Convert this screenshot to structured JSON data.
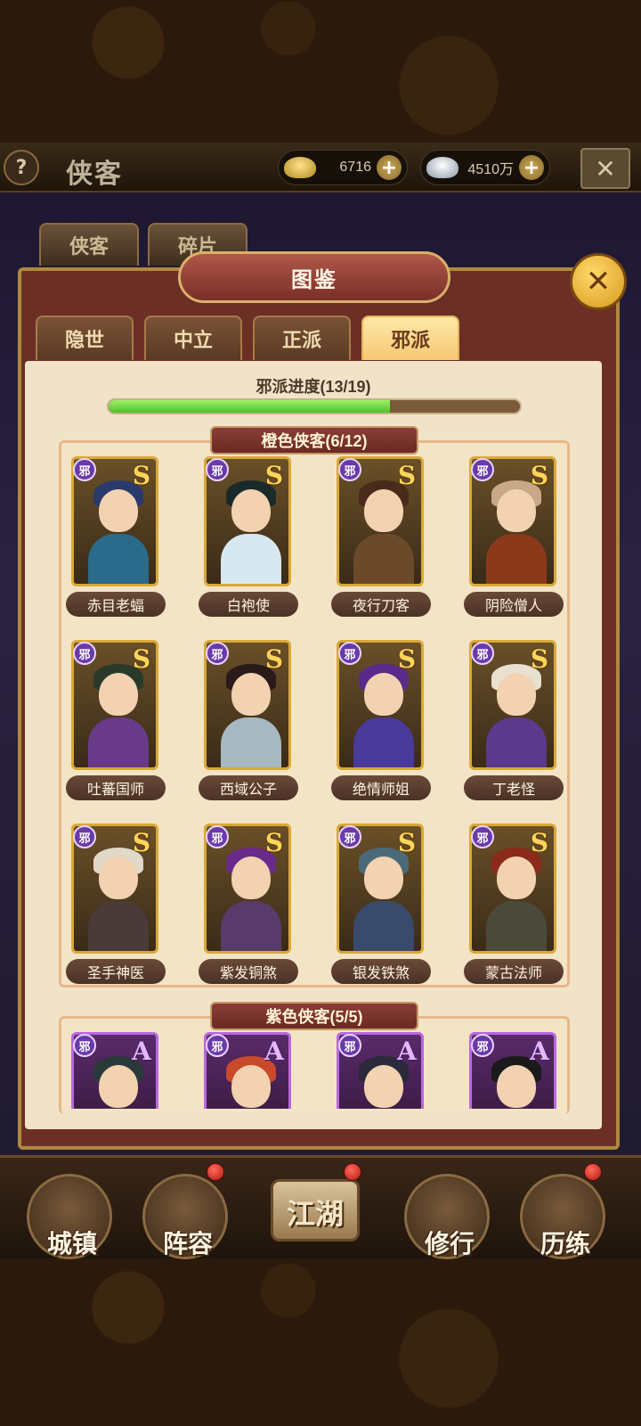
{
  "header": {
    "help_icon": "?",
    "title": "侠客",
    "gold": {
      "icon": "gold-ingot-icon",
      "value": "6716"
    },
    "silver": {
      "icon": "silver-ingot-icon",
      "value": "4510万"
    },
    "plus": "+",
    "close_icon": "✕"
  },
  "back_tabs": [
    "侠客",
    "碎片"
  ],
  "panel": {
    "title": "图鉴",
    "close_icon": "✕",
    "tabs": [
      "隐世",
      "中立",
      "正派",
      "邪派"
    ],
    "active_tab": "邪派",
    "progress_label": "邪派进度(13/19)",
    "progress_fraction": 0.684
  },
  "sections": {
    "orange": {
      "title": "橙色侠客(6/12)",
      "grade": "S",
      "heroes": [
        {
          "name": "赤目老蝠",
          "badge": "邪",
          "hair": "#2a3a6a",
          "body": "#2a6a8a"
        },
        {
          "name": "白袍使",
          "badge": "邪",
          "hair": "#1a2a2a",
          "body": "#d8e8f0"
        },
        {
          "name": "夜行刀客",
          "badge": "邪",
          "hair": "#4a2a1a",
          "body": "#6a4a2a"
        },
        {
          "name": "阴险僧人",
          "badge": "邪",
          "hair": "#c8a888",
          "body": "#8a3a1a"
        },
        {
          "name": "吐蕃国师",
          "badge": "邪",
          "hair": "#2a3a2a",
          "body": "#6a3a8a"
        },
        {
          "name": "西域公子",
          "badge": "邪",
          "hair": "#2a1a1a",
          "body": "#a8b8c0"
        },
        {
          "name": "绝情师姐",
          "badge": "邪",
          "hair": "#5a2a8a",
          "body": "#4a3a9a"
        },
        {
          "name": "丁老怪",
          "badge": "邪",
          "hair": "#e8e0d0",
          "body": "#5a3a8a"
        },
        {
          "name": "圣手神医",
          "badge": "邪",
          "hair": "#e0d8c8",
          "body": "#4a3a3a"
        },
        {
          "name": "紫发铜煞",
          "badge": "邪",
          "hair": "#6a2a8a",
          "body": "#5a3a6a"
        },
        {
          "name": "银发铁煞",
          "badge": "邪",
          "hair": "#4a6a7a",
          "body": "#3a4a6a"
        },
        {
          "name": "蒙古法师",
          "badge": "邪",
          "hair": "#8a2a1a",
          "body": "#4a4a3a"
        }
      ]
    },
    "purple": {
      "title": "紫色侠客(5/5)",
      "grade": "A",
      "heroes": [
        {
          "badge": "邪",
          "hair": "#2a3a3a",
          "body": "#3a4a4a"
        },
        {
          "badge": "邪",
          "hair": "#c84a2a",
          "body": "#6a3a2a"
        },
        {
          "badge": "邪",
          "hair": "#2a2a3a",
          "body": "#5a4a6a"
        },
        {
          "badge": "邪",
          "hair": "#1a1a1a",
          "body": "#3a2a3a"
        }
      ]
    }
  },
  "bottom_nav": [
    {
      "label": "城镇",
      "icon": "town-icon"
    },
    {
      "label": "阵容",
      "icon": "lineup-icon"
    },
    {
      "label": "江湖",
      "icon": "jianghu-scroll-icon"
    },
    {
      "label": "修行",
      "icon": "training-icon"
    },
    {
      "label": "历练",
      "icon": "trial-icon"
    }
  ]
}
